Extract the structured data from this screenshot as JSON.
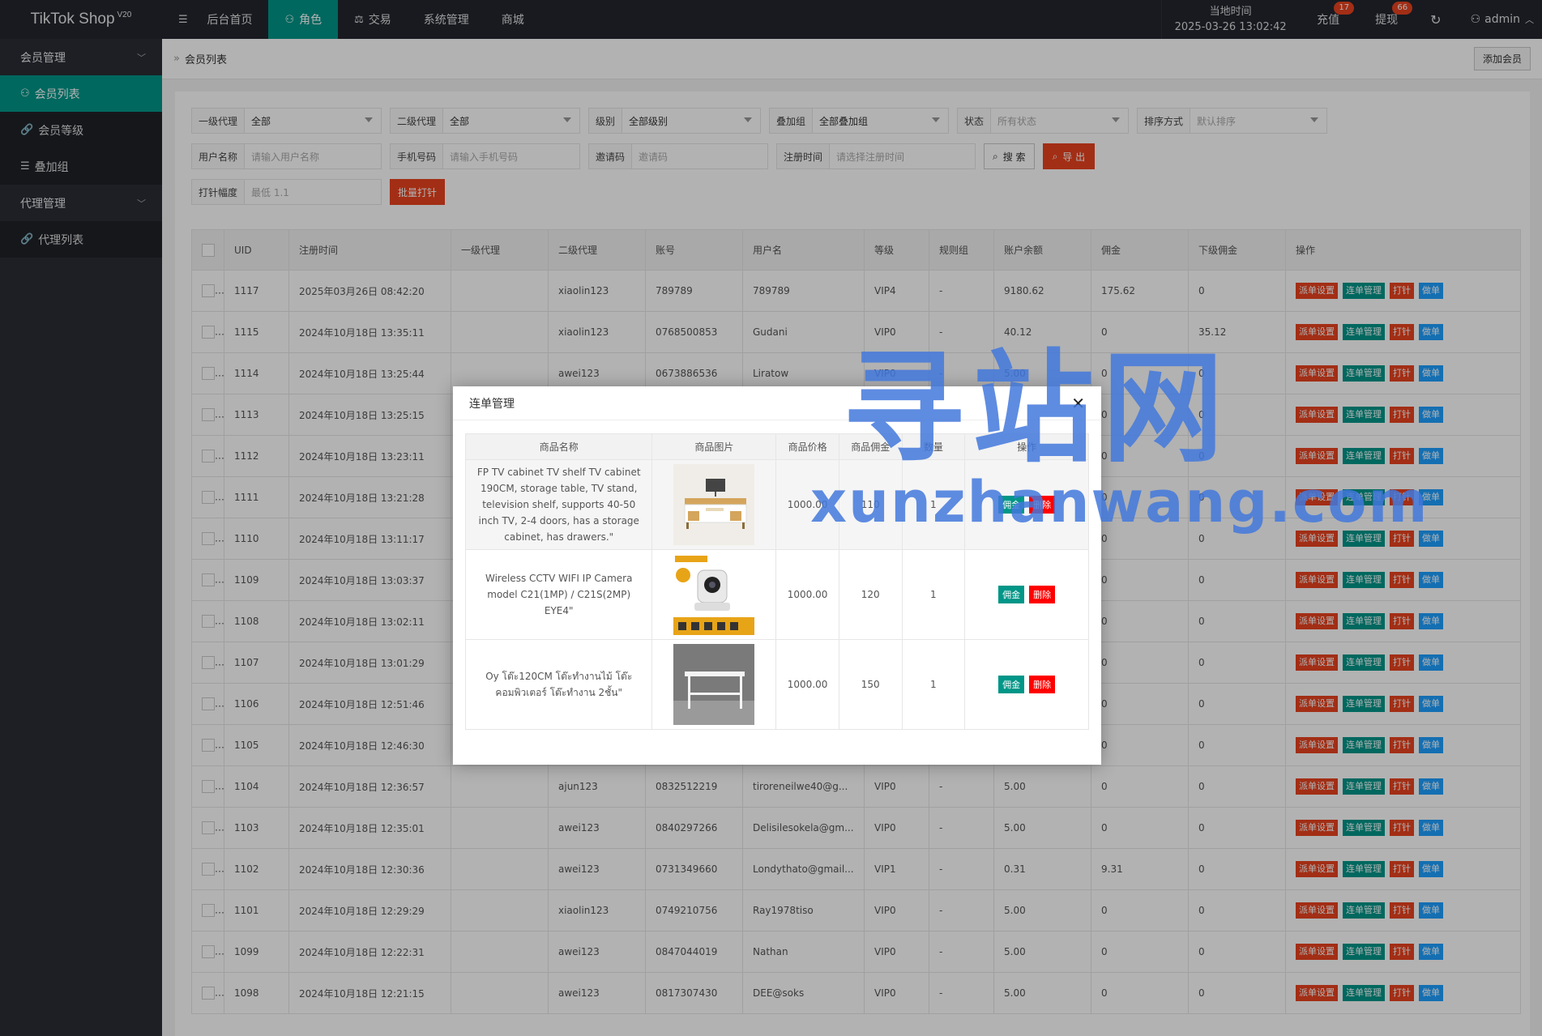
{
  "app": {
    "title": "TikTok Shop",
    "version": "V20"
  },
  "nav": [
    {
      "label": "后台首页",
      "icon": "menu-icon"
    },
    {
      "label": "角色",
      "icon": "user-icon"
    },
    {
      "label": "交易",
      "icon": "scale-icon"
    },
    {
      "label": "系统管理",
      "icon": ""
    },
    {
      "label": "商城",
      "icon": ""
    }
  ],
  "header": {
    "time_label": "当地时间",
    "time_value": "2025-03-26 13:02:42",
    "recharge_label": "充值",
    "recharge_badge": "17",
    "withdraw_label": "提现",
    "withdraw_badge": "66",
    "user": "admin"
  },
  "sidebar": {
    "groups": [
      {
        "label": "会员管理",
        "items": [
          {
            "label": "会员列表",
            "icon": "user-icon"
          },
          {
            "label": "会员等级",
            "icon": "link-icon"
          },
          {
            "label": "叠加组",
            "icon": "list-icon"
          }
        ]
      },
      {
        "label": "代理管理",
        "items": [
          {
            "label": "代理列表",
            "icon": "link-icon"
          }
        ]
      }
    ]
  },
  "breadcrumb": "会员列表",
  "add_member_label": "添加会员",
  "filters": {
    "agent1_label": "一级代理",
    "agent1_value": "全部",
    "agent2_label": "二级代理",
    "agent2_value": "全部",
    "level_label": "级别",
    "level_value": "全部级别",
    "group_label": "叠加组",
    "group_value": "全部叠加组",
    "status_label": "状态",
    "status_placeholder": "所有状态",
    "sort_label": "排序方式",
    "sort_placeholder": "默认排序",
    "username_label": "用户名称",
    "username_placeholder": "请输入用户名称",
    "phone_label": "手机号码",
    "phone_placeholder": "请输入手机号码",
    "invite_label": "邀请码",
    "invite_placeholder": "邀请码",
    "regtime_label": "注册时间",
    "regtime_placeholder": "请选择注册时间",
    "search_label": "搜 索",
    "export_label": "导 出",
    "amp_label": "打针幅度",
    "amp_placeholder": "最低 1.1",
    "batch_label": "批量打针"
  },
  "table": {
    "headers": [
      "UID",
      "注册时间",
      "一级代理",
      "二级代理",
      "账号",
      "用户名",
      "等级",
      "规则组",
      "账户余额",
      "佣金",
      "下级佣金",
      "操作"
    ],
    "actions": [
      "派单设置",
      "连单管理",
      "打针",
      "做单"
    ],
    "rows": [
      [
        "1117",
        "2025年03月26日 08:42:20",
        "",
        "xiaolin123",
        "789789",
        "789789",
        "VIP4",
        "-",
        "9180.62",
        "175.62",
        "0"
      ],
      [
        "1115",
        "2024年10月18日 13:35:11",
        "",
        "xiaolin123",
        "0768500853",
        "Gudani",
        "VIP0",
        "-",
        "40.12",
        "0",
        "35.12"
      ],
      [
        "1114",
        "2024年10月18日 13:25:44",
        "",
        "awei123",
        "0673886536",
        "Liratow",
        "VIP0",
        "-",
        "5.00",
        "0",
        "0"
      ],
      [
        "1113",
        "2024年10月18日 13:25:15",
        "",
        "",
        "",
        "",
        "",
        "",
        "",
        "0",
        "0"
      ],
      [
        "1112",
        "2024年10月18日 13:23:11",
        "",
        "",
        "",
        "",
        "",
        "",
        "",
        "0",
        "0"
      ],
      [
        "1111",
        "2024年10月18日 13:21:28",
        "",
        "",
        "",
        "",
        "",
        "",
        "",
        "0",
        "0"
      ],
      [
        "1110",
        "2024年10月18日 13:11:17",
        "",
        "",
        "",
        "",
        "",
        "",
        "",
        "0",
        "0"
      ],
      [
        "1109",
        "2024年10月18日 13:03:37",
        "",
        "",
        "",
        "",
        "",
        "",
        "",
        "0",
        "0"
      ],
      [
        "1108",
        "2024年10月18日 13:02:11",
        "",
        "",
        "",
        "",
        "",
        "",
        "",
        "0",
        "0"
      ],
      [
        "1107",
        "2024年10月18日 13:01:29",
        "",
        "",
        "",
        "",
        "",
        "",
        "",
        "0",
        "0"
      ],
      [
        "1106",
        "2024年10月18日 12:51:46",
        "",
        "",
        "",
        "",
        "",
        "",
        "",
        "0",
        "0"
      ],
      [
        "1105",
        "2024年10月18日 12:46:30",
        "",
        "",
        "",
        "",
        "",
        "",
        "",
        "0",
        "0"
      ],
      [
        "1104",
        "2024年10月18日 12:36:57",
        "",
        "ajun123",
        "0832512219",
        "tiroreneilwe40@g...",
        "VIP0",
        "-",
        "5.00",
        "0",
        "0"
      ],
      [
        "1103",
        "2024年10月18日 12:35:01",
        "",
        "awei123",
        "0840297266",
        "Delisilesokela@gm...",
        "VIP0",
        "-",
        "5.00",
        "0",
        "0"
      ],
      [
        "1102",
        "2024年10月18日 12:30:36",
        "",
        "awei123",
        "0731349660",
        "Londythato@gmail...",
        "VIP1",
        "-",
        "0.31",
        "9.31",
        "0"
      ],
      [
        "1101",
        "2024年10月18日 12:29:29",
        "",
        "xiaolin123",
        "0749210756",
        "Ray1978tiso",
        "VIP0",
        "-",
        "5.00",
        "0",
        "0"
      ],
      [
        "1099",
        "2024年10月18日 12:22:31",
        "",
        "awei123",
        "0847044019",
        "Nathan",
        "VIP0",
        "-",
        "5.00",
        "0",
        "0"
      ],
      [
        "1098",
        "2024年10月18日 12:21:15",
        "",
        "awei123",
        "0817307430",
        "DEE@soks",
        "VIP0",
        "-",
        "5.00",
        "0",
        "0"
      ]
    ]
  },
  "modal": {
    "title": "连单管理",
    "headers": [
      "商品名称",
      "商品图片",
      "商品价格",
      "商品佣金",
      "数量",
      "操作"
    ],
    "actions": [
      "佣金",
      "删除"
    ],
    "rows": [
      {
        "name": "FP TV cabinet TV shelf TV cabinet 190CM, storage table, TV stand, television shelf, supports 40-50 inch TV, 2-4 doors, has a storage cabinet, has drawers.\"",
        "image": "tv-cabinet-image",
        "price": "1000.00",
        "commission": "110",
        "qty": "1"
      },
      {
        "name": "Wireless CCTV WIFI IP Camera model C21(1MP) / C21S(2MP) EYE4\"",
        "image": "ip-camera-image",
        "price": "1000.00",
        "commission": "120",
        "qty": "1"
      },
      {
        "name": "Oy โต๊ะ120CM โต๊ะทำงานไม้ โต๊ะคอมพิวเตอร์ โต๊ะทำงาน 2ชั้น\"",
        "image": "white-desk-image",
        "price": "1000.00",
        "commission": "150",
        "qty": "1"
      }
    ]
  },
  "watermark": {
    "line1": "寻站网",
    "line2": "xunzhanwang.com"
  }
}
